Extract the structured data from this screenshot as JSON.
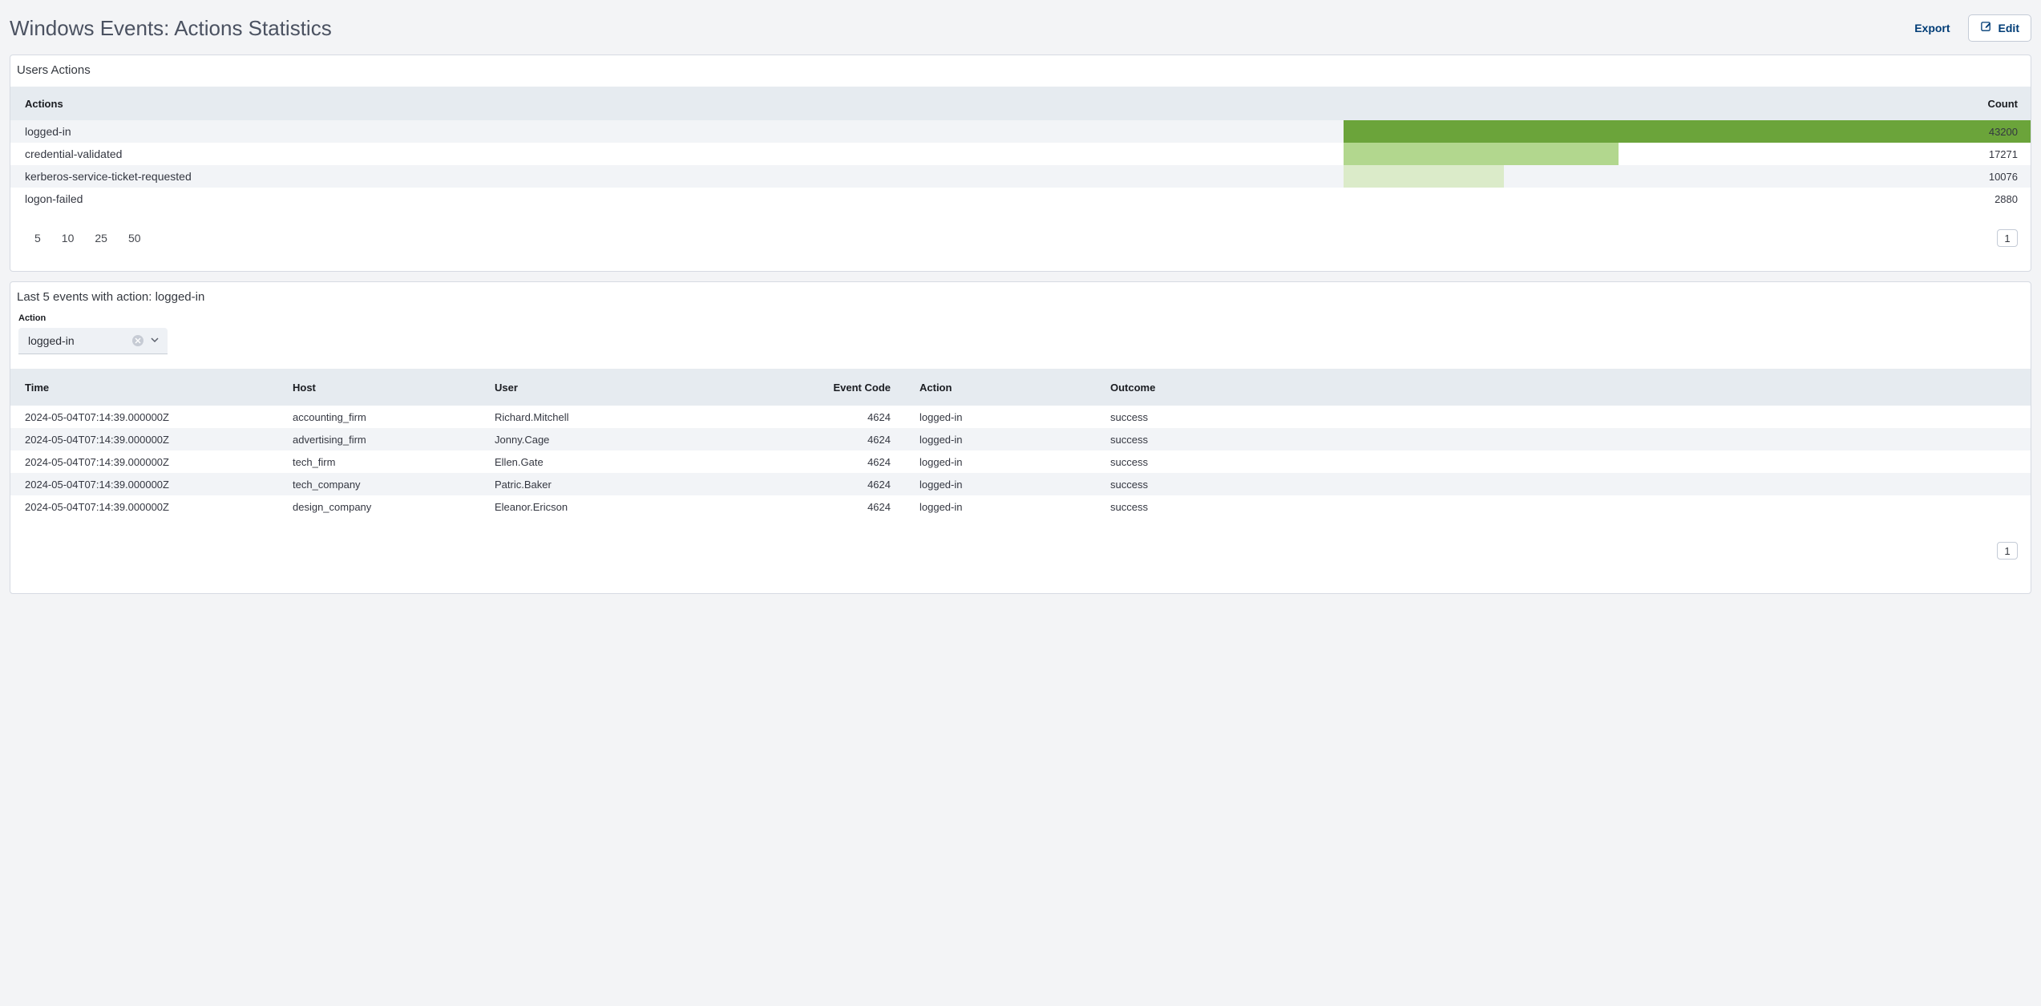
{
  "header": {
    "title": "Windows Events: Actions Statistics",
    "export_label": "Export",
    "edit_label": "Edit"
  },
  "panel1": {
    "title": "Users Actions",
    "columns": {
      "actions": "Actions",
      "count": "Count"
    },
    "rows": [
      {
        "action": "logged-in",
        "count": 43200
      },
      {
        "action": "credential-validated",
        "count": 17271
      },
      {
        "action": "kerberos-service-ticket-requested",
        "count": 10076
      },
      {
        "action": "logon-failed",
        "count": 2880
      }
    ],
    "bar_colors": [
      "#6ba43a",
      "#b2d78e",
      "#dbebc9"
    ],
    "page_sizes": [
      "5",
      "10",
      "25",
      "50"
    ],
    "page_number": "1"
  },
  "panel2": {
    "title": "Last 5 events with action: logged-in",
    "filter": {
      "label": "Action",
      "value": "logged-in"
    },
    "columns": {
      "time": "Time",
      "host": "Host",
      "user": "User",
      "event_code": "Event Code",
      "action": "Action",
      "outcome": "Outcome"
    },
    "rows": [
      {
        "time": "2024-05-04T07:14:39.000000Z",
        "host": "accounting_firm",
        "user": "Richard.Mitchell",
        "event_code": "4624",
        "action": "logged-in",
        "outcome": "success"
      },
      {
        "time": "2024-05-04T07:14:39.000000Z",
        "host": "advertising_firm",
        "user": "Jonny.Cage",
        "event_code": "4624",
        "action": "logged-in",
        "outcome": "success"
      },
      {
        "time": "2024-05-04T07:14:39.000000Z",
        "host": "tech_firm",
        "user": "Ellen.Gate",
        "event_code": "4624",
        "action": "logged-in",
        "outcome": "success"
      },
      {
        "time": "2024-05-04T07:14:39.000000Z",
        "host": "tech_company",
        "user": "Patric.Baker",
        "event_code": "4624",
        "action": "logged-in",
        "outcome": "success"
      },
      {
        "time": "2024-05-04T07:14:39.000000Z",
        "host": "design_company",
        "user": "Eleanor.Ericson",
        "event_code": "4624",
        "action": "logged-in",
        "outcome": "success"
      }
    ],
    "page_number": "1"
  },
  "chart_data": {
    "type": "bar",
    "orientation": "horizontal",
    "title": "Users Actions",
    "xlabel": "Count",
    "ylabel": "Actions",
    "categories": [
      "logged-in",
      "credential-validated",
      "kerberos-service-ticket-requested",
      "logon-failed"
    ],
    "values": [
      43200,
      17271,
      10076,
      2880
    ]
  }
}
